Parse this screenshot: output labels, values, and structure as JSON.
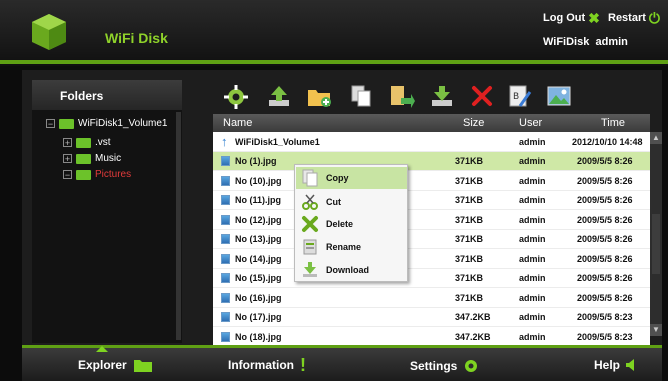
{
  "header": {
    "brand": "WiFi Disk",
    "logout_label": "Log Out",
    "restart_label": "Restart",
    "device_name": "WiFiDisk",
    "username": "admin"
  },
  "sidebar": {
    "title": "Folders",
    "root": "WiFiDisk1_Volume1",
    "children": [
      {
        "label": ".vst",
        "expander": "+"
      },
      {
        "label": "Music",
        "expander": "+"
      },
      {
        "label": "Pictures",
        "expander": "−",
        "selected": true
      }
    ]
  },
  "toolbar": {
    "buttons": [
      "settings-icon",
      "upload-icon",
      "new-folder-icon",
      "copy-icon",
      "move-icon",
      "download-icon",
      "delete-icon",
      "rename-icon",
      "image-view-icon"
    ]
  },
  "table": {
    "columns": [
      "Name",
      "Size",
      "User",
      "Time"
    ],
    "parent_row": {
      "name": "WiFiDisk1_Volume1",
      "size": "",
      "user": "admin",
      "time": "2012/10/10 14:48"
    },
    "rows": [
      {
        "name": "No (1).jpg",
        "size": "371KB",
        "user": "admin",
        "time": "2009/5/5 8:26",
        "selected": true
      },
      {
        "name": "No (10).jpg",
        "size": "371KB",
        "user": "admin",
        "time": "2009/5/5 8:26"
      },
      {
        "name": "No (11).jpg",
        "size": "371KB",
        "user": "admin",
        "time": "2009/5/5 8:26"
      },
      {
        "name": "No (12).jpg",
        "size": "371KB",
        "user": "admin",
        "time": "2009/5/5 8:26"
      },
      {
        "name": "No (13).jpg",
        "size": "371KB",
        "user": "admin",
        "time": "2009/5/5 8:26"
      },
      {
        "name": "No (14).jpg",
        "size": "371KB",
        "user": "admin",
        "time": "2009/5/5 8:26"
      },
      {
        "name": "No (15).jpg",
        "size": "371KB",
        "user": "admin",
        "time": "2009/5/5 8:26"
      },
      {
        "name": "No (16).jpg",
        "size": "371KB",
        "user": "admin",
        "time": "2009/5/5 8:26"
      },
      {
        "name": "No (17).jpg",
        "size": "347.2KB",
        "user": "admin",
        "time": "2009/5/5 8:23"
      },
      {
        "name": "No (18).jpg",
        "size": "347.2KB",
        "user": "admin",
        "time": "2009/5/5 8:23"
      }
    ]
  },
  "context_menu": {
    "items": [
      {
        "label": "Copy",
        "icon": "copy-icon",
        "highlighted": true
      },
      {
        "label": "Cut",
        "icon": "scissors-icon"
      },
      {
        "label": "Delete",
        "icon": "delete-icon"
      },
      {
        "label": "Rename",
        "icon": "rename-icon"
      },
      {
        "label": "Download",
        "icon": "download-icon"
      }
    ]
  },
  "footer": {
    "tabs": [
      {
        "label": "Explorer",
        "icon": "folder-icon",
        "active": true
      },
      {
        "label": "Information",
        "icon": "exclamation-icon"
      },
      {
        "label": "Settings",
        "icon": "gear-icon"
      },
      {
        "label": "Help",
        "icon": "speaker-icon"
      }
    ]
  },
  "colors": {
    "accent": "#7ed321",
    "selection": "#cfe8a6",
    "header_bg": "#1a1a1a"
  }
}
